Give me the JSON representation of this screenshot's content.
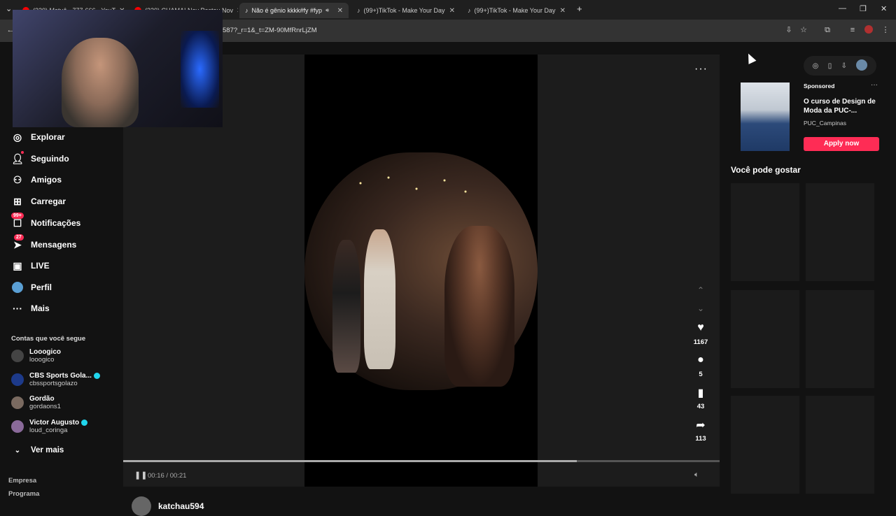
{
  "browser": {
    "tabs": [
      {
        "title": "(320) Matuê - 777-666 - YouT",
        "favicon_color": "#ff0000",
        "active": false
      },
      {
        "title": "(320) CHAMA! Ney Postou Nov",
        "favicon_color": "#ff0000",
        "active": false
      },
      {
        "title": "Não é gênio kkkk#fy #fyp",
        "favicon_color": "#ffffff",
        "active": true
      },
      {
        "title": "(99+)TikTok - Make Your Day",
        "favicon_color": "#ffffff",
        "active": false
      },
      {
        "title": "(99+)TikTok - Make Your Day",
        "favicon_color": "#ffffff",
        "active": false
      }
    ],
    "new_tab": "+",
    "url": "587?_r=1&_t=ZM-90MfRnrLjZM"
  },
  "sidebar": {
    "nav": [
      {
        "label": "Explorar",
        "icon": "compass-icon",
        "badge": ""
      },
      {
        "label": "Seguindo",
        "icon": "following-icon",
        "badge": ""
      },
      {
        "label": "Amigos",
        "icon": "friends-icon",
        "badge": ""
      },
      {
        "label": "Carregar",
        "icon": "upload-icon",
        "badge": ""
      },
      {
        "label": "Notificações",
        "icon": "inbox-icon",
        "badge": "99+"
      },
      {
        "label": "Mensagens",
        "icon": "messages-icon",
        "badge": "27"
      },
      {
        "label": "LIVE",
        "icon": "live-icon",
        "badge": ""
      },
      {
        "label": "Perfil",
        "icon": "profile-icon",
        "badge": ""
      },
      {
        "label": "Mais",
        "icon": "more-icon",
        "badge": ""
      }
    ],
    "following_title": "Contas que você segue",
    "following": [
      {
        "name": "Looogico",
        "user": "looogico",
        "verified": false
      },
      {
        "name": "CBS Sports Gola...",
        "user": "cbssportsgolazo",
        "verified": true
      },
      {
        "name": "Gordão",
        "user": "gordaons1",
        "verified": false
      },
      {
        "name": "Victor Augusto",
        "user": "loud_coringa",
        "verified": true
      }
    ],
    "see_more": "Ver mais",
    "footer": [
      "Empresa",
      "Programa"
    ]
  },
  "player": {
    "likes": "1167",
    "comments": "5",
    "saves": "43",
    "shares": "113",
    "time": "00:16 / 00:21",
    "progress": 0.76,
    "author": "katchau594"
  },
  "right": {
    "sponsored": "Sponsored",
    "ad_title": "O curso de Design de Moda da PUC-...",
    "ad_author": "PUC_Campinas",
    "apply": "Apply now",
    "suggest_title": "Você pode gostar"
  }
}
